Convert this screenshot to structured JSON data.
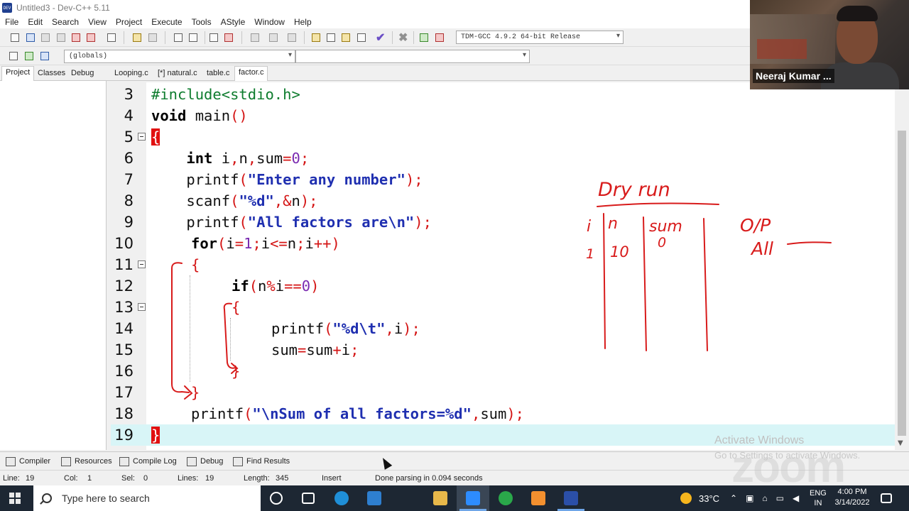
{
  "window": {
    "title": "Untitled3 - Dev-C++ 5.11",
    "app_icon_text": "DEV"
  },
  "menu": [
    "File",
    "Edit",
    "Search",
    "View",
    "Project",
    "Execute",
    "Tools",
    "AStyle",
    "Window",
    "Help"
  ],
  "toolbar": {
    "compiler_select": "TDM-GCC 4.9.2 64-bit Release",
    "scope_select": "(globals)",
    "member_select": ""
  },
  "left_tabs": [
    "Project",
    "Classes",
    "Debug"
  ],
  "file_tabs": [
    "Looping.c",
    "[*] natural.c",
    "table.c",
    "factor.c"
  ],
  "active_file_tab": "factor.c",
  "editor": {
    "line_numbers": [
      "3",
      "4",
      "5",
      "6",
      "7",
      "8",
      "9",
      "10",
      "11",
      "12",
      "13",
      "14",
      "15",
      "16",
      "17",
      "18",
      "19"
    ],
    "lines": {
      "l3_include": "#include<stdio.h>",
      "l4_void": "void",
      "l4_main": " main",
      "l4_parens": "()",
      "l5_brace": "{",
      "l6_indent": "    ",
      "l6_int": "int",
      "l6_rest1": " i",
      "l6_c1": ",",
      "l6_n": "n",
      "l6_c2": ",",
      "l6_sum": "sum",
      "l6_eq": "=",
      "l6_zero": "0",
      "l6_semi": ";",
      "l7_printf": "    printf",
      "l7_open": "(",
      "l7_str": "\"Enter any number\"",
      "l7_close": ");",
      "l8_scanf": "    scanf",
      "l8_open": "(",
      "l8_str": "\"%d\"",
      "l8_comma": ",&",
      "l8_n": "n",
      "l8_close": ");",
      "l9_printf": "    printf",
      "l9_open": "(",
      "l9_str": "\"All factors are\\n\"",
      "l9_close": ");",
      "l10_for": "for",
      "l10_p1": "(",
      "l10_i": "i",
      "l10_eq": "=",
      "l10_one": "1",
      "l10_s1": ";",
      "l10_i2": "i",
      "l10_le": "<=",
      "l10_n": "n",
      "l10_s2": ";",
      "l10_i3": "i",
      "l10_pp": "++",
      "l10_p2": ")",
      "l11_brace": "{",
      "l12_if": "if",
      "l12_p1": "(",
      "l12_n": "n",
      "l12_mod": "%",
      "l12_i": "i",
      "l12_eqeq": "==",
      "l12_zero": "0",
      "l12_p2": ")",
      "l13_brace": "{",
      "l14_printf": "printf",
      "l14_open": "(",
      "l14_str": "\"%d\\t\"",
      "l14_comma": ",",
      "l14_i": "i",
      "l14_close": ");",
      "l15_sum": "sum",
      "l15_eq": "=",
      "l15_sum2": "sum",
      "l15_plus": "+",
      "l15_i": "i",
      "l15_semi": ";",
      "l16_brace": "}",
      "l17_brace": "}",
      "l18_printf": "printf",
      "l18_open": "(",
      "l18_str": "\"\\nSum of all factors=%d\"",
      "l18_comma": ",",
      "l18_sum": "sum",
      "l18_close": ");",
      "l19_brace": "}"
    }
  },
  "annotations": {
    "dry_run_title": "Dry run",
    "col_i": "i",
    "col_n": "n",
    "col_sum": "sum",
    "row1_i": "1",
    "row1_n": "10",
    "row1_sum": "0",
    "output_label": "O/P",
    "output_value": "All"
  },
  "bottom_tabs": [
    "Compiler",
    "Resources",
    "Compile Log",
    "Debug",
    "Find Results"
  ],
  "status": {
    "line_label": "Line:",
    "line_value": "19",
    "col_label": "Col:",
    "col_value": "1",
    "sel_label": "Sel:",
    "sel_value": "0",
    "lines_label": "Lines:",
    "lines_value": "19",
    "length_label": "Length:",
    "length_value": "345",
    "mode": "Insert",
    "message": "Done parsing in 0.094 seconds"
  },
  "webcam": {
    "participant_name": "Neeraj Kumar ..."
  },
  "watermark": {
    "activate_title": "Activate Windows",
    "activate_sub": "Go to Settings to activate Windows.",
    "zoom": "zoom"
  },
  "taskbar": {
    "search_placeholder": "Type here to search",
    "weather": "33°C",
    "language_top": "ENG",
    "language_bottom": "IN",
    "time": "4:00 PM",
    "date": "3/14/2022"
  },
  "colors": {
    "brace_highlight": "#e11010",
    "string": "#1f2fb0",
    "number": "#7a2ab0",
    "punct": "#d41414",
    "current_line": "#d8f5f7",
    "annotation_ink": "#d81b1b"
  }
}
